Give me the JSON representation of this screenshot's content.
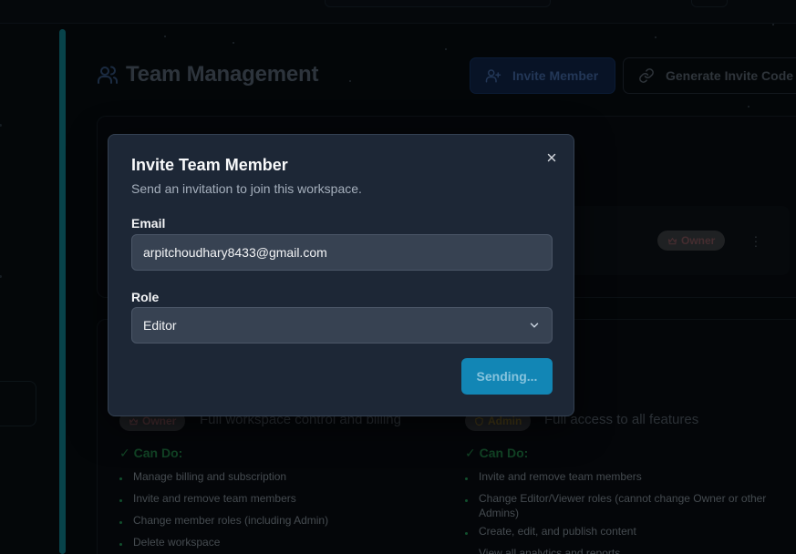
{
  "page": {
    "title": "Team Management",
    "invite_button": "Invite Member",
    "generate_button": "Generate Invite Code"
  },
  "member_row": {
    "role_badge": "Owner"
  },
  "roles": {
    "owner": {
      "badge": "Owner",
      "description": "Full workspace control and billing",
      "can_do_title": "✓ Can Do:",
      "items": [
        "Manage billing and subscription",
        "Invite and remove team members",
        "Change member roles (including Admin)",
        "Delete workspace"
      ]
    },
    "admin": {
      "badge": "Admin",
      "description": "Full access to all features",
      "can_do_title": "✓ Can Do:",
      "items": [
        "Invite and remove team members",
        "Change Editor/Viewer roles (cannot change Owner or other Admins)",
        "Create, edit, and publish content",
        "View all analytics and reports"
      ]
    }
  },
  "modal": {
    "title": "Invite Team Member",
    "subtitle": "Send an invitation to join this workspace.",
    "email_label": "Email",
    "email_value": "arpitchoudhary8433@gmail.com",
    "role_label": "Role",
    "role_value": "Editor",
    "submit_label": "Sending..."
  },
  "colors": {
    "modal_bg": "#1d2736",
    "primary": "#1286b5",
    "input_bg": "#374252"
  }
}
